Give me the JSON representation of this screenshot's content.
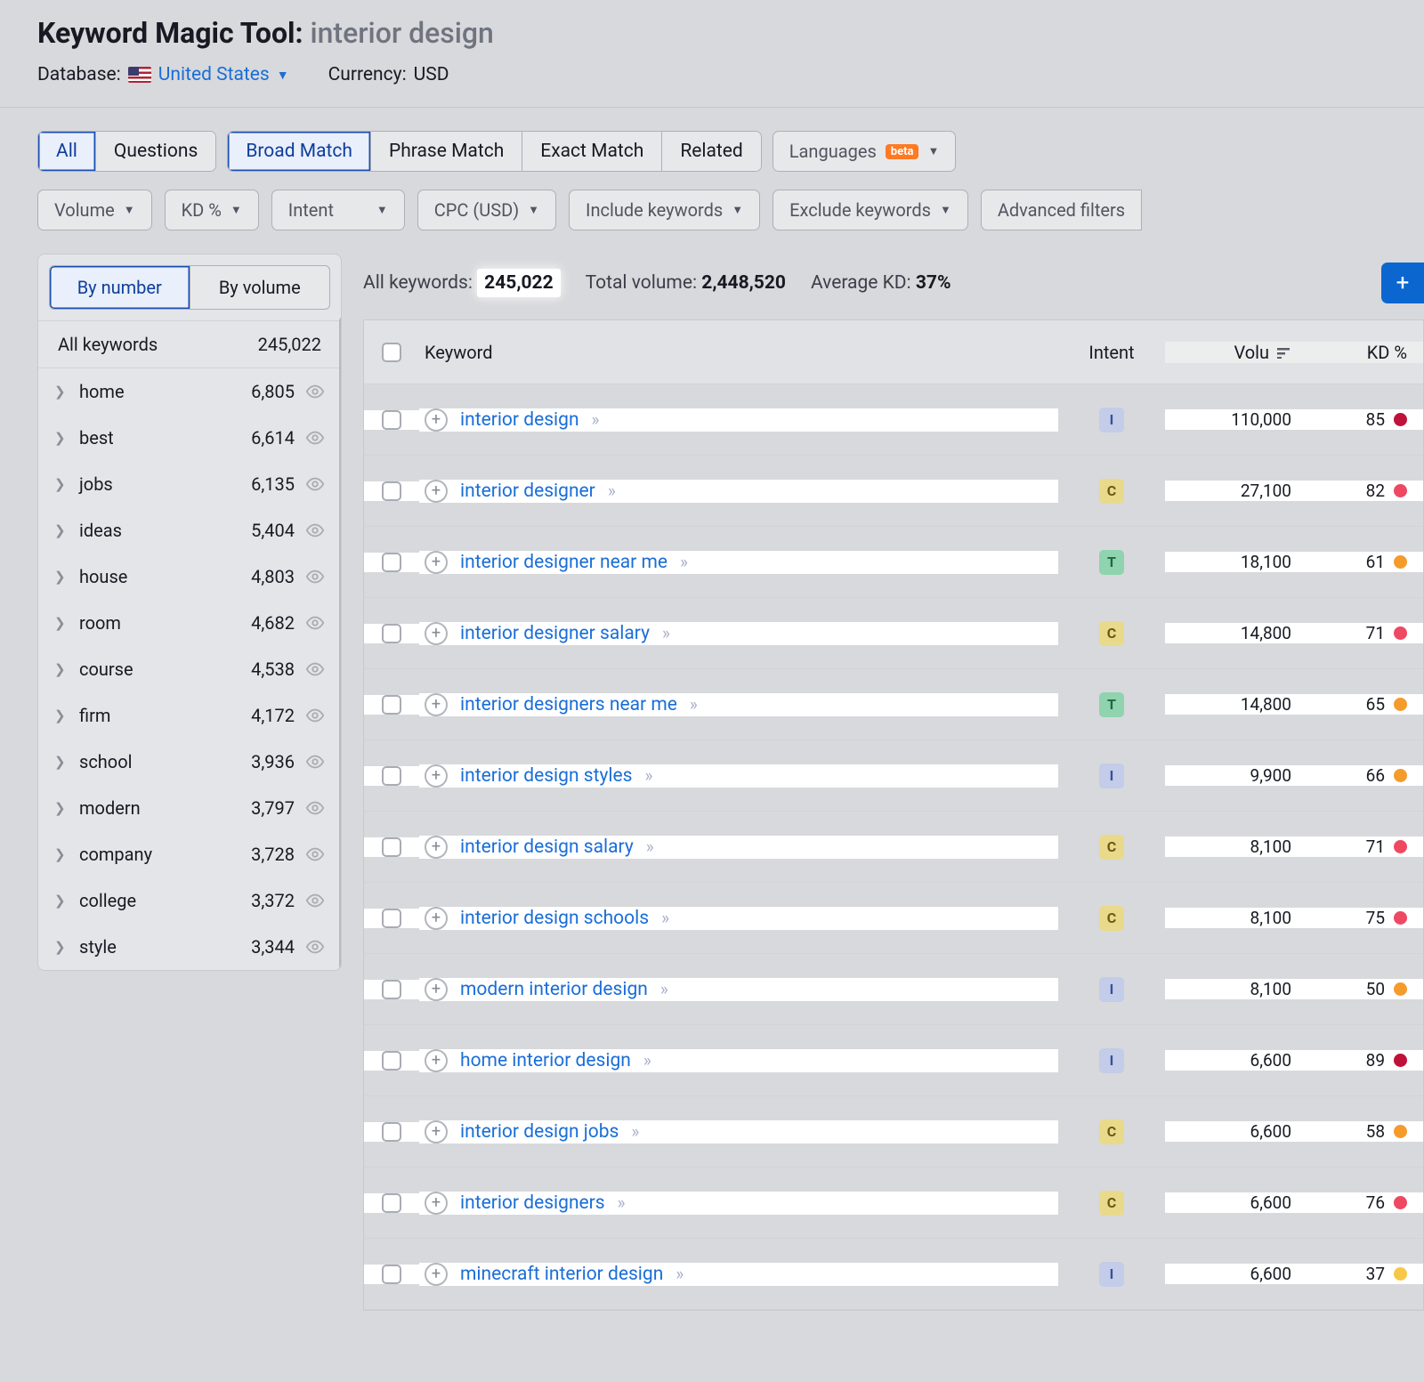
{
  "header": {
    "tool_name": "Keyword Magic Tool:",
    "query": "interior design",
    "database_label": "Database:",
    "database_value": "United States",
    "currency_label": "Currency:",
    "currency_value": "USD"
  },
  "tabs_primary": [
    {
      "label": "All",
      "active": true
    },
    {
      "label": "Questions",
      "active": false
    }
  ],
  "tabs_match": [
    {
      "label": "Broad Match",
      "active": true
    },
    {
      "label": "Phrase Match",
      "active": false
    },
    {
      "label": "Exact Match",
      "active": false
    },
    {
      "label": "Related",
      "active": false
    }
  ],
  "languages": {
    "label": "Languages",
    "badge": "beta"
  },
  "filters": [
    "Volume",
    "KD %",
    "Intent",
    "CPC (USD)",
    "Include keywords",
    "Exclude keywords",
    "Advanced filters"
  ],
  "sidebar": {
    "toggle": {
      "by_number": "By number",
      "by_volume": "By volume"
    },
    "header_label": "All keywords",
    "header_count": "245,022",
    "groups": [
      {
        "name": "home",
        "count": "6,805"
      },
      {
        "name": "best",
        "count": "6,614"
      },
      {
        "name": "jobs",
        "count": "6,135"
      },
      {
        "name": "ideas",
        "count": "5,404"
      },
      {
        "name": "house",
        "count": "4,803"
      },
      {
        "name": "room",
        "count": "4,682"
      },
      {
        "name": "course",
        "count": "4,538"
      },
      {
        "name": "firm",
        "count": "4,172"
      },
      {
        "name": "school",
        "count": "3,936"
      },
      {
        "name": "modern",
        "count": "3,797"
      },
      {
        "name": "company",
        "count": "3,728"
      },
      {
        "name": "college",
        "count": "3,372"
      },
      {
        "name": "style",
        "count": "3,344"
      }
    ]
  },
  "stats": {
    "all_label": "All keywords:",
    "all_value": "245,022",
    "vol_label": "Total volume:",
    "vol_value": "2,448,520",
    "kd_label": "Average KD:",
    "kd_value": "37%"
  },
  "columns": {
    "keyword": "Keyword",
    "intent": "Intent",
    "volume": "Volu",
    "kd": "KD %"
  },
  "rows": [
    {
      "keyword": "interior design",
      "intent": "I",
      "volume": "110,000",
      "kd": "85",
      "kd_color": "#c0113a"
    },
    {
      "keyword": "interior designer",
      "intent": "C",
      "volume": "27,100",
      "kd": "82",
      "kd_color": "#ee4862"
    },
    {
      "keyword": "interior designer near me",
      "intent": "T",
      "volume": "18,100",
      "kd": "61",
      "kd_color": "#f59b2c"
    },
    {
      "keyword": "interior designer salary",
      "intent": "C",
      "volume": "14,800",
      "kd": "71",
      "kd_color": "#ee4862"
    },
    {
      "keyword": "interior designers near me",
      "intent": "T",
      "volume": "14,800",
      "kd": "65",
      "kd_color": "#f59b2c"
    },
    {
      "keyword": "interior design styles",
      "intent": "I",
      "volume": "9,900",
      "kd": "66",
      "kd_color": "#f59b2c"
    },
    {
      "keyword": "interior design salary",
      "intent": "C",
      "volume": "8,100",
      "kd": "71",
      "kd_color": "#ee4862"
    },
    {
      "keyword": "interior design schools",
      "intent": "C",
      "volume": "8,100",
      "kd": "75",
      "kd_color": "#ee4862"
    },
    {
      "keyword": "modern interior design",
      "intent": "I",
      "volume": "8,100",
      "kd": "50",
      "kd_color": "#f59b2c"
    },
    {
      "keyword": "home interior design",
      "intent": "I",
      "volume": "6,600",
      "kd": "89",
      "kd_color": "#c0113a"
    },
    {
      "keyword": "interior design jobs",
      "intent": "C",
      "volume": "6,600",
      "kd": "58",
      "kd_color": "#f59b2c"
    },
    {
      "keyword": "interior designers",
      "intent": "C",
      "volume": "6,600",
      "kd": "76",
      "kd_color": "#ee4862"
    },
    {
      "keyword": "minecraft interior design",
      "intent": "I",
      "volume": "6,600",
      "kd": "37",
      "kd_color": "#f5c846"
    }
  ]
}
